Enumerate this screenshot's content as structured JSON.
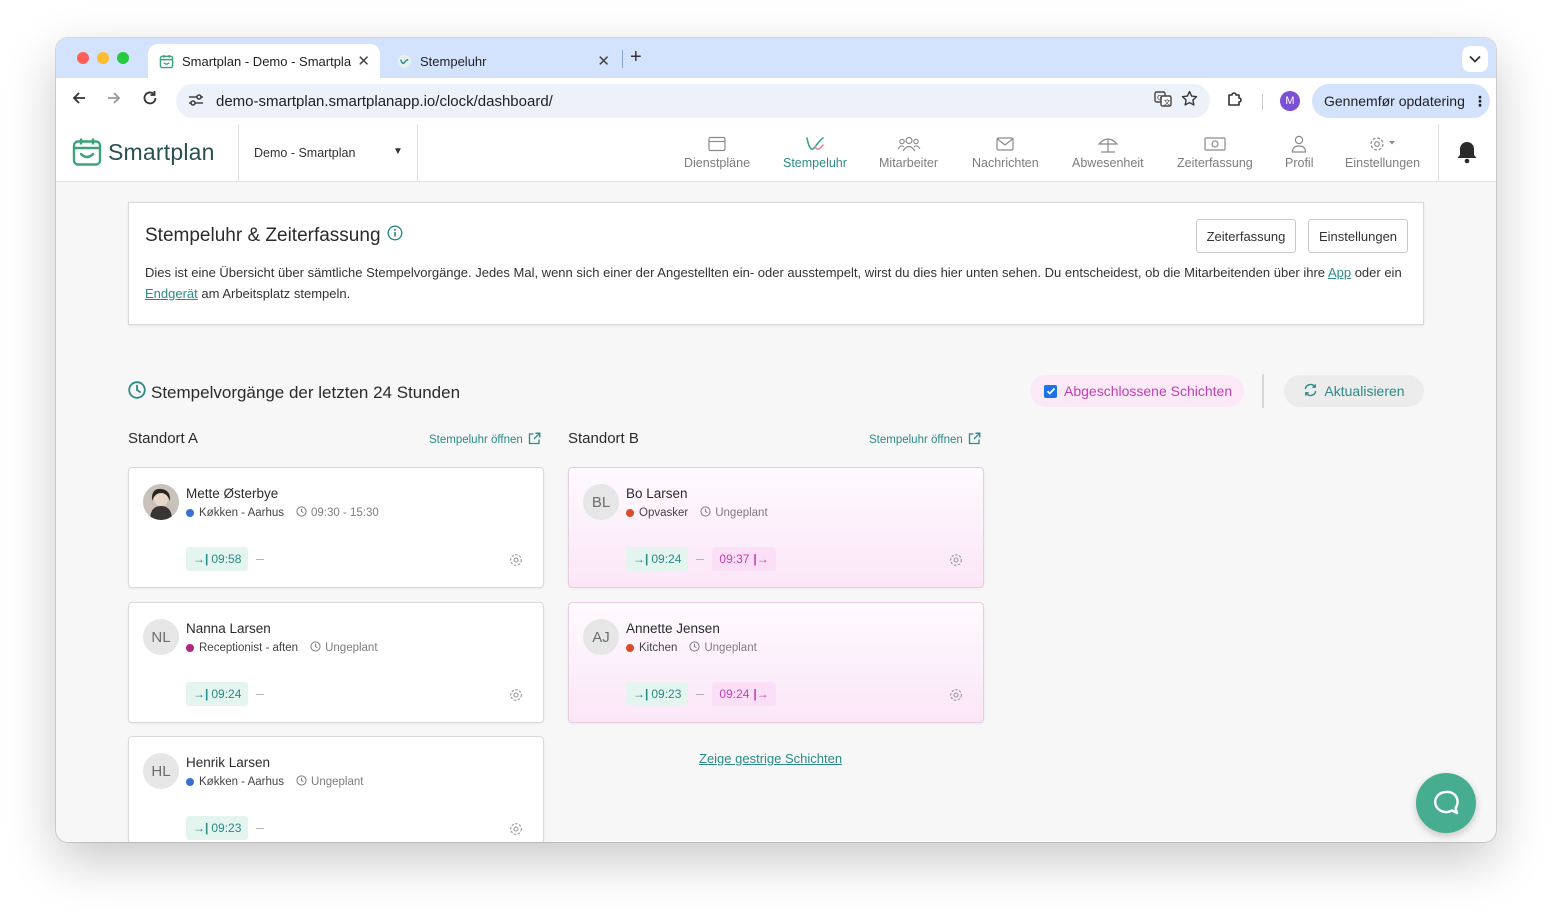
{
  "browser": {
    "tabs": [
      {
        "title": "Smartplan - Demo - Smartplan",
        "active": true
      },
      {
        "title": "Stempeluhr",
        "active": false
      }
    ],
    "new_tab": "+",
    "url": "demo-smartplan.smartplanapp.io/clock/dashboard/",
    "profile_initial": "M",
    "update_label": "Gennemfør opdatering"
  },
  "app": {
    "logo_text": "Smartplan",
    "org_selector": "Demo - Smartplan",
    "nav": [
      {
        "label": "Dienstpläne",
        "icon": "calendar-icon",
        "active": false
      },
      {
        "label": "Stempeluhr",
        "icon": "stempeluhr-icon",
        "active": true
      },
      {
        "label": "Mitarbeiter",
        "icon": "people-icon",
        "active": false
      },
      {
        "label": "Nachrichten",
        "icon": "envelope-icon",
        "active": false
      },
      {
        "label": "Abwesenheit",
        "icon": "umbrella-icon",
        "active": false
      },
      {
        "label": "Zeiterfassung",
        "icon": "money-icon",
        "active": false
      },
      {
        "label": "Profil",
        "icon": "user-icon",
        "active": false
      },
      {
        "label": "Einstellungen",
        "icon": "gear-icon",
        "active": false
      }
    ]
  },
  "info": {
    "title": "Stempeluhr & Zeiterfassung",
    "btn_zeiterfassung": "Zeiterfassung",
    "btn_einstellungen": "Einstellungen",
    "desc_part1": "Dies ist eine Übersicht über sämtliche Stempelvorgänge. Jedes Mal, wenn sich einer der Angestellten ein- oder ausstempelt, wirst du dies hier unten sehen. Du entscheidest, ob die Mitarbeitenden über ihre ",
    "link_app": "App",
    "desc_part2": " oder ein ",
    "link_device": "Endgerät",
    "desc_part3": " am Arbeitsplatz stempeln."
  },
  "section": {
    "title": "Stempelvorgänge der letzten 24 Stunden",
    "checkbox_label": "Abgeschlossene Schichten",
    "refresh_label": "Aktualisieren"
  },
  "locations": [
    {
      "name": "Standort A",
      "open_link": "Stempeluhr öffnen",
      "cards": [
        {
          "initials": "",
          "name": "Mette Østerbye",
          "role": "Køkken - Aarhus",
          "role_color": "#3a6fd8",
          "shift": "09:30 - 15:30",
          "in": "09:58",
          "out": ""
        },
        {
          "initials": "NL",
          "name": "Nanna Larsen",
          "role": "Receptionist - aften",
          "role_color": "#b0267f",
          "shift": "Ungeplant",
          "in": "09:24",
          "out": ""
        },
        {
          "initials": "HL",
          "name": "Henrik Larsen",
          "role": "Køkken - Aarhus",
          "role_color": "#3a6fd8",
          "shift": "Ungeplant",
          "in": "09:23",
          "out": ""
        }
      ]
    },
    {
      "name": "Standort B",
      "open_link": "Stempeluhr öffnen",
      "cards": [
        {
          "initials": "BL",
          "name": "Bo Larsen",
          "role": "Opvasker",
          "role_color": "#d84a2a",
          "shift": "Ungeplant",
          "in": "09:24",
          "out": "09:37"
        },
        {
          "initials": "AJ",
          "name": "Annette Jensen",
          "role": "Kitchen",
          "role_color": "#d84a2a",
          "shift": "Ungeplant",
          "in": "09:23",
          "out": "09:24"
        }
      ]
    }
  ],
  "yesterday_link": "Zeige gestrige Schichten"
}
